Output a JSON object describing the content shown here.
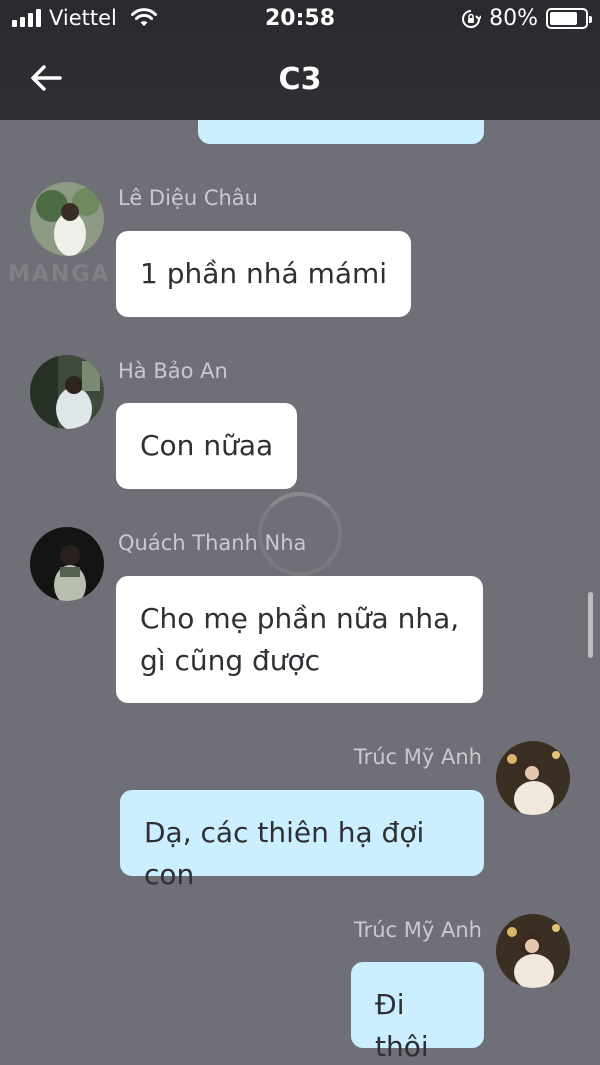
{
  "status_bar": {
    "carrier": "Viettel",
    "time": "20:58",
    "battery": "80%",
    "battery_level": 0.8
  },
  "header": {
    "title": "C3"
  },
  "watermark": "MANGA YOON",
  "messages": [
    {
      "sender": "Lê Diệu Châu",
      "text": "1 phần nhá mámi",
      "side": "left"
    },
    {
      "sender": "Hà Bảo An",
      "text": "Con nữaa",
      "side": "left"
    },
    {
      "sender": "Quách Thanh Nha",
      "text_lines": [
        "Cho mẹ phần nữa nha,",
        "gì cũng được"
      ],
      "side": "left"
    },
    {
      "sender": "Trúc Mỹ Anh",
      "text": "Dạ, các thiên hạ đợi con",
      "side": "right"
    },
    {
      "sender": "Trúc Mỹ Anh",
      "text": "Đi thôi",
      "side": "right"
    }
  ],
  "colors": {
    "background": "#6f6f77",
    "header": "#2b2d31",
    "bubble_incoming": "#ffffff",
    "bubble_outgoing": "#ccefff"
  }
}
